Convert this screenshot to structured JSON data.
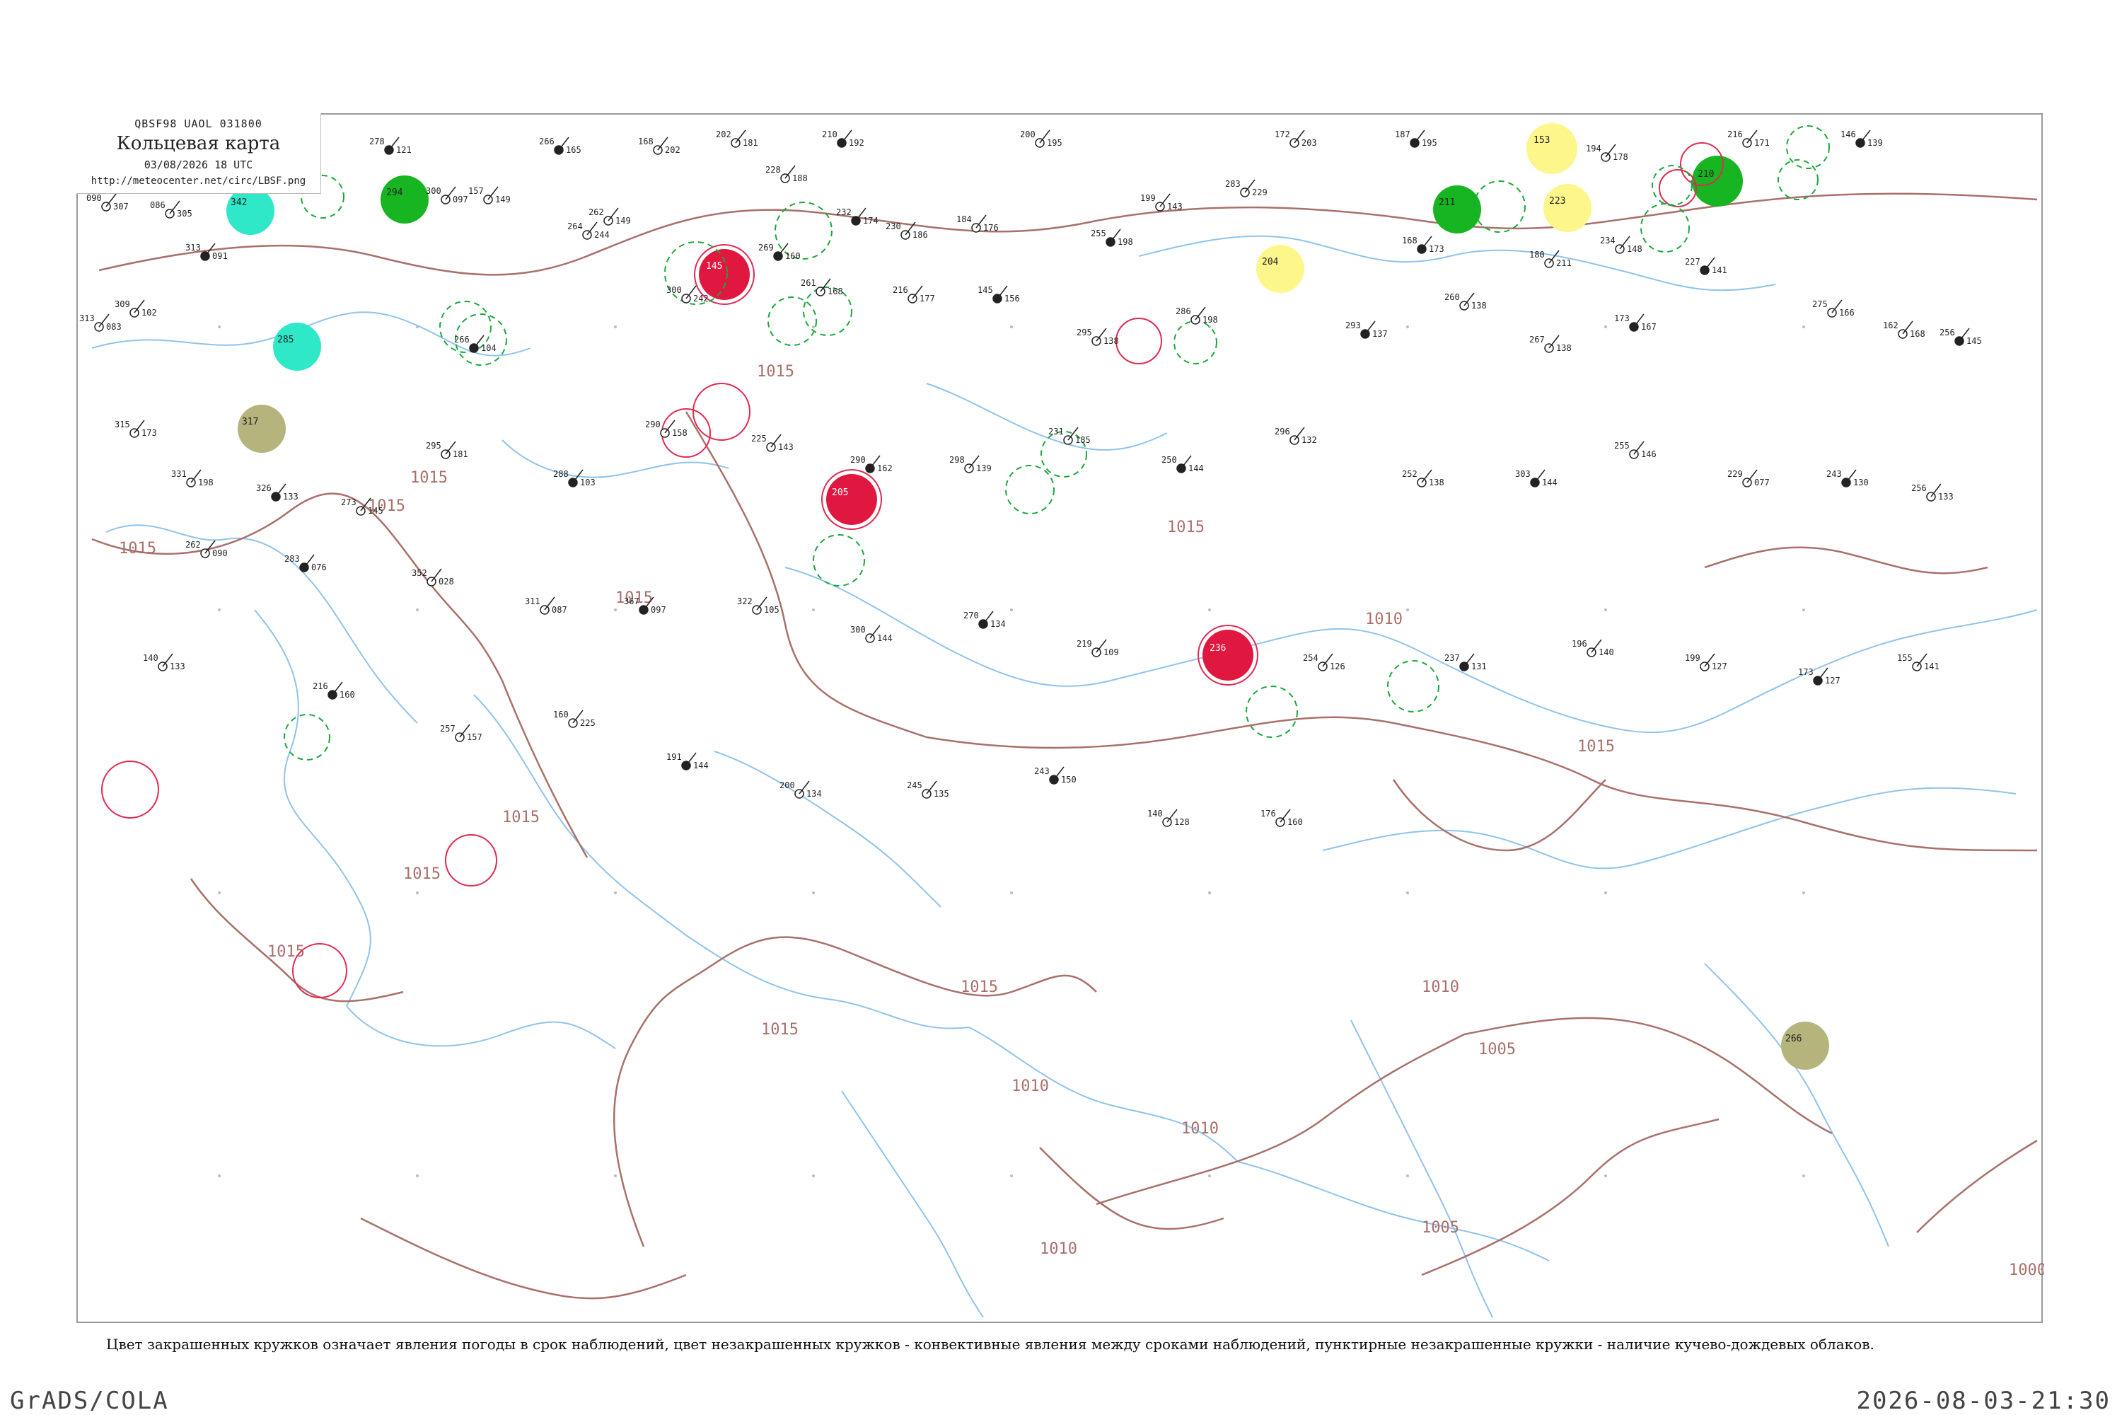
{
  "title_block": {
    "code_line": "QBSF98  UAOL  031800",
    "title": "Кольцевая карта",
    "time": "03/08/2026 18 UTC",
    "url": "http://meteocenter.net/circ/LBSF.png"
  },
  "footnote": "Цвет закрашенных кружков означает явления погоды в срок наблюдений, цвет незакрашенных кружков - конвективные явления между сроками наблюдений, пунктирные незакрашенные кружки - наличие кучево-дождевых облаков.",
  "credit": "GrADS/COLA",
  "timestamp": "2026-08-03-21:30",
  "colors": {
    "isobar": "#a9706a",
    "water": "#8fc3ec",
    "station": "#222222",
    "green_fill": "#17b521",
    "cyan_fill": "#2ee8c8",
    "red_fill": "#e0173f",
    "yellow_fill": "#fdf68a",
    "olive_fill": "#b4b47c",
    "red_ring": "#e02a52",
    "green_ring": "#19a83a"
  },
  "isobar_labels": [
    "1015",
    "1015",
    "1015",
    "1015",
    "1015",
    "1015",
    "1015",
    "1015",
    "1015",
    "1015",
    "1015",
    "1015",
    "1010",
    "1010",
    "1010",
    "1010",
    "1010",
    "1005",
    "1005",
    "1000"
  ],
  "highlights": [
    {
      "kind": "filled",
      "color": "green",
      "label": "294"
    },
    {
      "kind": "filled",
      "color": "cyan",
      "label": "342"
    },
    {
      "kind": "filled",
      "color": "cyan",
      "label": "285"
    },
    {
      "kind": "filled",
      "color": "olive",
      "label": "317"
    },
    {
      "kind": "filled",
      "color": "red",
      "label": "145"
    },
    {
      "kind": "filled",
      "color": "red",
      "label": "205"
    },
    {
      "kind": "filled",
      "color": "red",
      "label": "236"
    },
    {
      "kind": "filled",
      "color": "yellow",
      "label": "153"
    },
    {
      "kind": "filled",
      "color": "yellow",
      "label": "223"
    },
    {
      "kind": "filled",
      "color": "yellow",
      "label": "204"
    },
    {
      "kind": "filled",
      "color": "green",
      "label": "211"
    },
    {
      "kind": "filled",
      "color": "green",
      "label": "210"
    },
    {
      "kind": "filled",
      "color": "olive",
      "label": "266"
    }
  ],
  "stations": [
    {
      "t": "278",
      "p": "121"
    },
    {
      "t": "300",
      "p": "097"
    },
    {
      "t": "157",
      "p": "149"
    },
    {
      "t": "266",
      "p": "165"
    },
    {
      "t": "168",
      "p": "202"
    },
    {
      "t": "202",
      "p": "181"
    },
    {
      "t": "210",
      "p": "192"
    },
    {
      "t": "200",
      "p": "195"
    },
    {
      "t": "172",
      "p": "203"
    },
    {
      "t": "187",
      "p": "195"
    },
    {
      "t": "194",
      "p": "178"
    },
    {
      "t": "216",
      "p": "171"
    },
    {
      "t": "146",
      "p": "139"
    },
    {
      "t": "090",
      "p": "307"
    },
    {
      "t": "086",
      "p": "305"
    },
    {
      "t": "313",
      "p": "091"
    },
    {
      "t": "262",
      "p": "149"
    },
    {
      "t": "228",
      "p": "188"
    },
    {
      "t": "232",
      "p": "174"
    },
    {
      "t": "230",
      "p": "186"
    },
    {
      "t": "184",
      "p": "176"
    },
    {
      "t": "255",
      "p": "198"
    },
    {
      "t": "199",
      "p": "143"
    },
    {
      "t": "283",
      "p": "229"
    },
    {
      "t": "168",
      "p": "173"
    },
    {
      "t": "180",
      "p": "211"
    },
    {
      "t": "234",
      "p": "148"
    },
    {
      "t": "227",
      "p": "141"
    },
    {
      "t": "313",
      "p": "083"
    },
    {
      "t": "309",
      "p": "102"
    },
    {
      "t": "266",
      "p": "104"
    },
    {
      "t": "264",
      "p": "244"
    },
    {
      "t": "300",
      "p": "242"
    },
    {
      "t": "269",
      "p": "160"
    },
    {
      "t": "261",
      "p": "168"
    },
    {
      "t": "216",
      "p": "177"
    },
    {
      "t": "145",
      "p": "156"
    },
    {
      "t": "295",
      "p": "138"
    },
    {
      "t": "286",
      "p": "198"
    },
    {
      "t": "293",
      "p": "137"
    },
    {
      "t": "260",
      "p": "138"
    },
    {
      "t": "267",
      "p": "138"
    },
    {
      "t": "173",
      "p": "167"
    },
    {
      "t": "275",
      "p": "166"
    },
    {
      "t": "162",
      "p": "168"
    },
    {
      "t": "256",
      "p": "145"
    },
    {
      "t": "315",
      "p": "173"
    },
    {
      "t": "331",
      "p": "198"
    },
    {
      "t": "326",
      "p": "133"
    },
    {
      "t": "273",
      "p": "145"
    },
    {
      "t": "295",
      "p": "181"
    },
    {
      "t": "288",
      "p": "103"
    },
    {
      "t": "290",
      "p": "158"
    },
    {
      "t": "225",
      "p": "143"
    },
    {
      "t": "290",
      "p": "162"
    },
    {
      "t": "298",
      "p": "139"
    },
    {
      "t": "231",
      "p": "185"
    },
    {
      "t": "250",
      "p": "144"
    },
    {
      "t": "296",
      "p": "132"
    },
    {
      "t": "252",
      "p": "138"
    },
    {
      "t": "303",
      "p": "144"
    },
    {
      "t": "255",
      "p": "146"
    },
    {
      "t": "229",
      "p": "077"
    },
    {
      "t": "243",
      "p": "130"
    },
    {
      "t": "256",
      "p": "133"
    },
    {
      "t": "262",
      "p": "090"
    },
    {
      "t": "283",
      "p": "076"
    },
    {
      "t": "352",
      "p": "028"
    },
    {
      "t": "311",
      "p": "087"
    },
    {
      "t": "367",
      "p": "097"
    },
    {
      "t": "322",
      "p": "105"
    },
    {
      "t": "300",
      "p": "144"
    },
    {
      "t": "270",
      "p": "134"
    },
    {
      "t": "219",
      "p": "109"
    },
    {
      "t": "254",
      "p": "126"
    },
    {
      "t": "237",
      "p": "131"
    },
    {
      "t": "196",
      "p": "140"
    },
    {
      "t": "199",
      "p": "127"
    },
    {
      "t": "173",
      "p": "127"
    },
    {
      "t": "155",
      "p": "141"
    },
    {
      "t": "140",
      "p": "133"
    },
    {
      "t": "216",
      "p": "160"
    },
    {
      "t": "257",
      "p": "157"
    },
    {
      "t": "160",
      "p": "225"
    },
    {
      "t": "191",
      "p": "144"
    },
    {
      "t": "200",
      "p": "134"
    },
    {
      "t": "245",
      "p": "135"
    },
    {
      "t": "243",
      "p": "150"
    },
    {
      "t": "140",
      "p": "128"
    },
    {
      "t": "176",
      "p": "160"
    }
  ]
}
